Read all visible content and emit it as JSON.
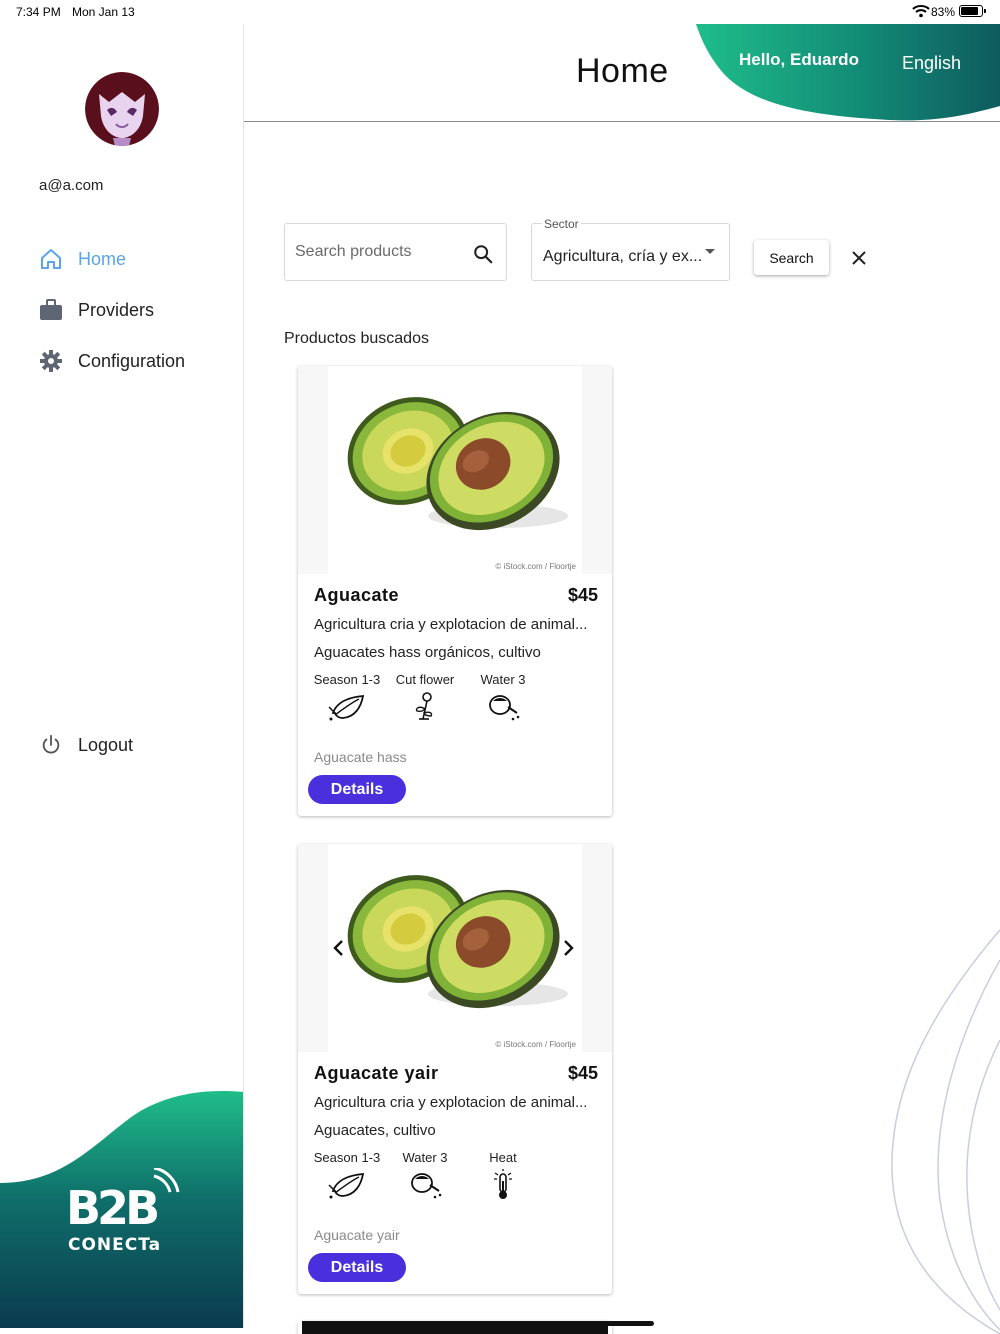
{
  "status_bar": {
    "time": "7:34 PM",
    "date": "Mon Jan 13",
    "battery": "83%"
  },
  "sidebar": {
    "email": "a@a.com",
    "items": [
      {
        "label": "Home",
        "icon": "home-icon",
        "active": true
      },
      {
        "label": "Providers",
        "icon": "briefcase-icon",
        "active": false
      },
      {
        "label": "Configuration",
        "icon": "gear-icon",
        "active": false
      }
    ],
    "logout_label": "Logout",
    "logo_text": {
      "top": "B2B",
      "bottom": "CONECTa"
    }
  },
  "header": {
    "title": "Home",
    "greeting": "Hello, Eduardo",
    "language": "English"
  },
  "filters": {
    "search_placeholder": "Search products",
    "sector_label": "Sector",
    "sector_value": "Agricultura, cría y ex...",
    "search_button": "Search"
  },
  "results": {
    "title": "Productos buscados",
    "products": [
      {
        "name": "Aguacate",
        "price": "$45",
        "sector": "Agricultura cria y explotacion de animal...",
        "keywords": "Aguacates hass orgánicos, cultivo",
        "attributes": [
          {
            "label": "Season 1-3",
            "icon": "leaf-icon"
          },
          {
            "label": "Cut flower",
            "icon": "flower-icon"
          },
          {
            "label": "Water 3",
            "icon": "watering-can-icon"
          }
        ],
        "variety": "Aguacate hass",
        "details_label": "Details",
        "image_credit": "© iStock.com / Floortje"
      },
      {
        "name": "Aguacate yair",
        "price": "$45",
        "sector": "Agricultura cria y explotacion de animal...",
        "keywords": "Aguacates, cultivo",
        "attributes": [
          {
            "label": "Season 1-3",
            "icon": "leaf-icon"
          },
          {
            "label": "Water 3",
            "icon": "watering-can-icon"
          },
          {
            "label": "Heat",
            "icon": "thermometer-icon"
          }
        ],
        "variety": "Aguacate yair",
        "details_label": "Details",
        "image_credit": "© iStock.com / Floortje"
      }
    ]
  },
  "colors": {
    "accent_green": "#1fbd8a",
    "dark_teal": "#0b3b4e",
    "primary_button": "#4a2fdd",
    "active_nav": "#5aa5e8"
  }
}
